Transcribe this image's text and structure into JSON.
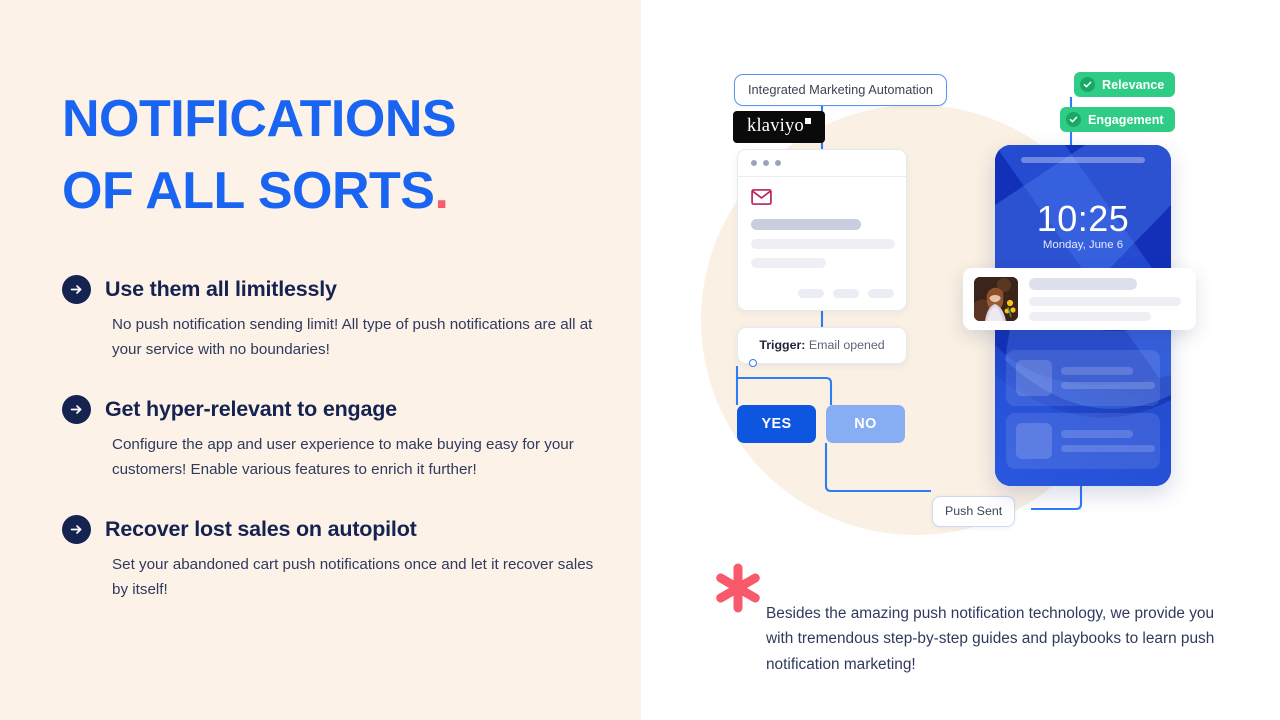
{
  "theme": {
    "left_bg": "#FCF2E8",
    "right_bg": "#FFFFFF",
    "blob": "#FAF0E3",
    "heading_blue": "#1964F0",
    "accent_coral": "#F8596B",
    "navy": "#152350",
    "body_text": "#2F3A5C",
    "flow_blue": "#2E7CF6",
    "yes_blue": "#0E56E0",
    "no_blue": "#87AEF3",
    "green": "#2ECC84",
    "green_dark": "#17A866",
    "phone_blue": "#1231B8",
    "envelope_crimson": "#B8245C"
  },
  "left": {
    "headline_line1": "NOTIFICATIONS",
    "headline_line2": "OF ALL SORTS",
    "headline_period": ".",
    "features": [
      {
        "icon": "arrow-right-circle-icon",
        "title": "Use them all limitlessly",
        "body": "No push notification sending limit! All type of push notifications are all at your service with no boundaries!"
      },
      {
        "icon": "arrow-right-circle-icon",
        "title": "Get hyper-relevant to engage",
        "body": "Configure the app and user experience to make buying easy for your customers! Enable various features to enrich it further!"
      },
      {
        "icon": "arrow-right-circle-icon",
        "title": "Recover lost sales on autopilot",
        "body": "Set your abandoned cart push notifications once and let it recover sales by itself!"
      }
    ]
  },
  "right": {
    "flow": {
      "integration_label": "Integrated Marketing Automation",
      "brand_badge": "klaviyo",
      "email_card": {
        "icon": "envelope-icon",
        "window_dots": 3,
        "placeholder_bars": 3,
        "pill_buttons": 3
      },
      "trigger": {
        "key": "Trigger:",
        "value": "Email opened"
      },
      "branches": [
        {
          "label": "YES",
          "state": "selected"
        },
        {
          "label": "NO",
          "state": "muted"
        }
      ],
      "push_sent_label": "Push Sent"
    },
    "badges": [
      {
        "label": "Relevance",
        "icon": "check-circle-icon"
      },
      {
        "label": "Engagement",
        "icon": "check-circle-icon"
      }
    ],
    "phone": {
      "time": "10:25",
      "date": "Monday, June 6",
      "ghost_notifications": 2
    },
    "notification": {
      "avatar": "woman-portrait-thumbnail",
      "placeholder_bars": 3
    },
    "footer": {
      "icon": "asterisk-icon",
      "text": "Besides the amazing push notification technology, we provide you with tremendous step-by-step guides and playbooks to learn push notification marketing!"
    }
  }
}
